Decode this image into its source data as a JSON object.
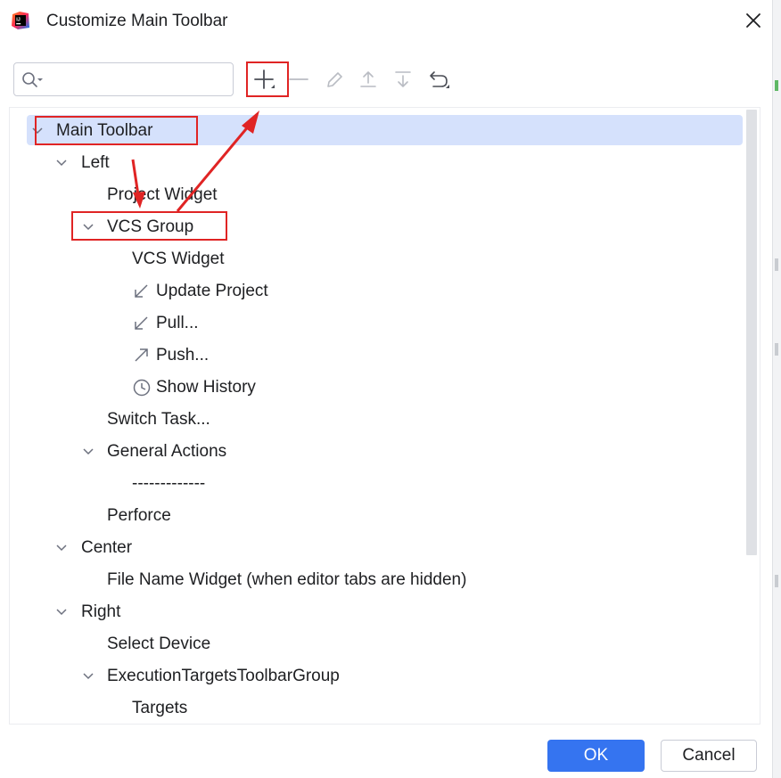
{
  "dialog": {
    "title": "Customize Main Toolbar",
    "app_icon": "intellij-idea-icon",
    "close_icon": "close-icon"
  },
  "search": {
    "value": "",
    "placeholder": "",
    "icon": "search-icon"
  },
  "toolbar": {
    "buttons": [
      {
        "name": "add-button",
        "icon": "plus-icon",
        "enabled": true
      },
      {
        "name": "remove-button",
        "icon": "minus-icon",
        "enabled": false
      },
      {
        "name": "edit-button",
        "icon": "pencil-icon",
        "enabled": false
      },
      {
        "name": "move-up-button",
        "icon": "arrow-up-icon",
        "enabled": false
      },
      {
        "name": "move-down-button",
        "icon": "arrow-down-icon",
        "enabled": false
      },
      {
        "name": "restore-button",
        "icon": "undo-icon",
        "enabled": true
      }
    ]
  },
  "tree": {
    "items": [
      {
        "label": "Main Toolbar",
        "expanded": true,
        "selected": true
      },
      {
        "label": "Left",
        "expanded": true
      },
      {
        "label": "Project Widget"
      },
      {
        "label": "VCS Group",
        "expanded": true
      },
      {
        "label": "VCS Widget"
      },
      {
        "label": "Update Project",
        "icon": "update-arrow-icon"
      },
      {
        "label": "Pull...",
        "icon": "pull-arrow-icon"
      },
      {
        "label": "Push...",
        "icon": "push-arrow-icon"
      },
      {
        "label": "Show History",
        "icon": "clock-icon"
      },
      {
        "label": "Switch Task..."
      },
      {
        "label": "General Actions",
        "expanded": true
      },
      {
        "label": "-------------"
      },
      {
        "label": "Perforce"
      },
      {
        "label": "Center",
        "expanded": true
      },
      {
        "label": "File Name Widget (when editor tabs are hidden)"
      },
      {
        "label": "Right",
        "expanded": true
      },
      {
        "label": "Select Device"
      },
      {
        "label": "ExecutionTargetsToolbarGroup",
        "expanded": true
      },
      {
        "label": "Targets"
      }
    ]
  },
  "footer": {
    "ok_label": "OK",
    "cancel_label": "Cancel"
  },
  "colors": {
    "accent": "#3574f0",
    "selection": "#d5e1fc",
    "annotation": "#e02424"
  }
}
